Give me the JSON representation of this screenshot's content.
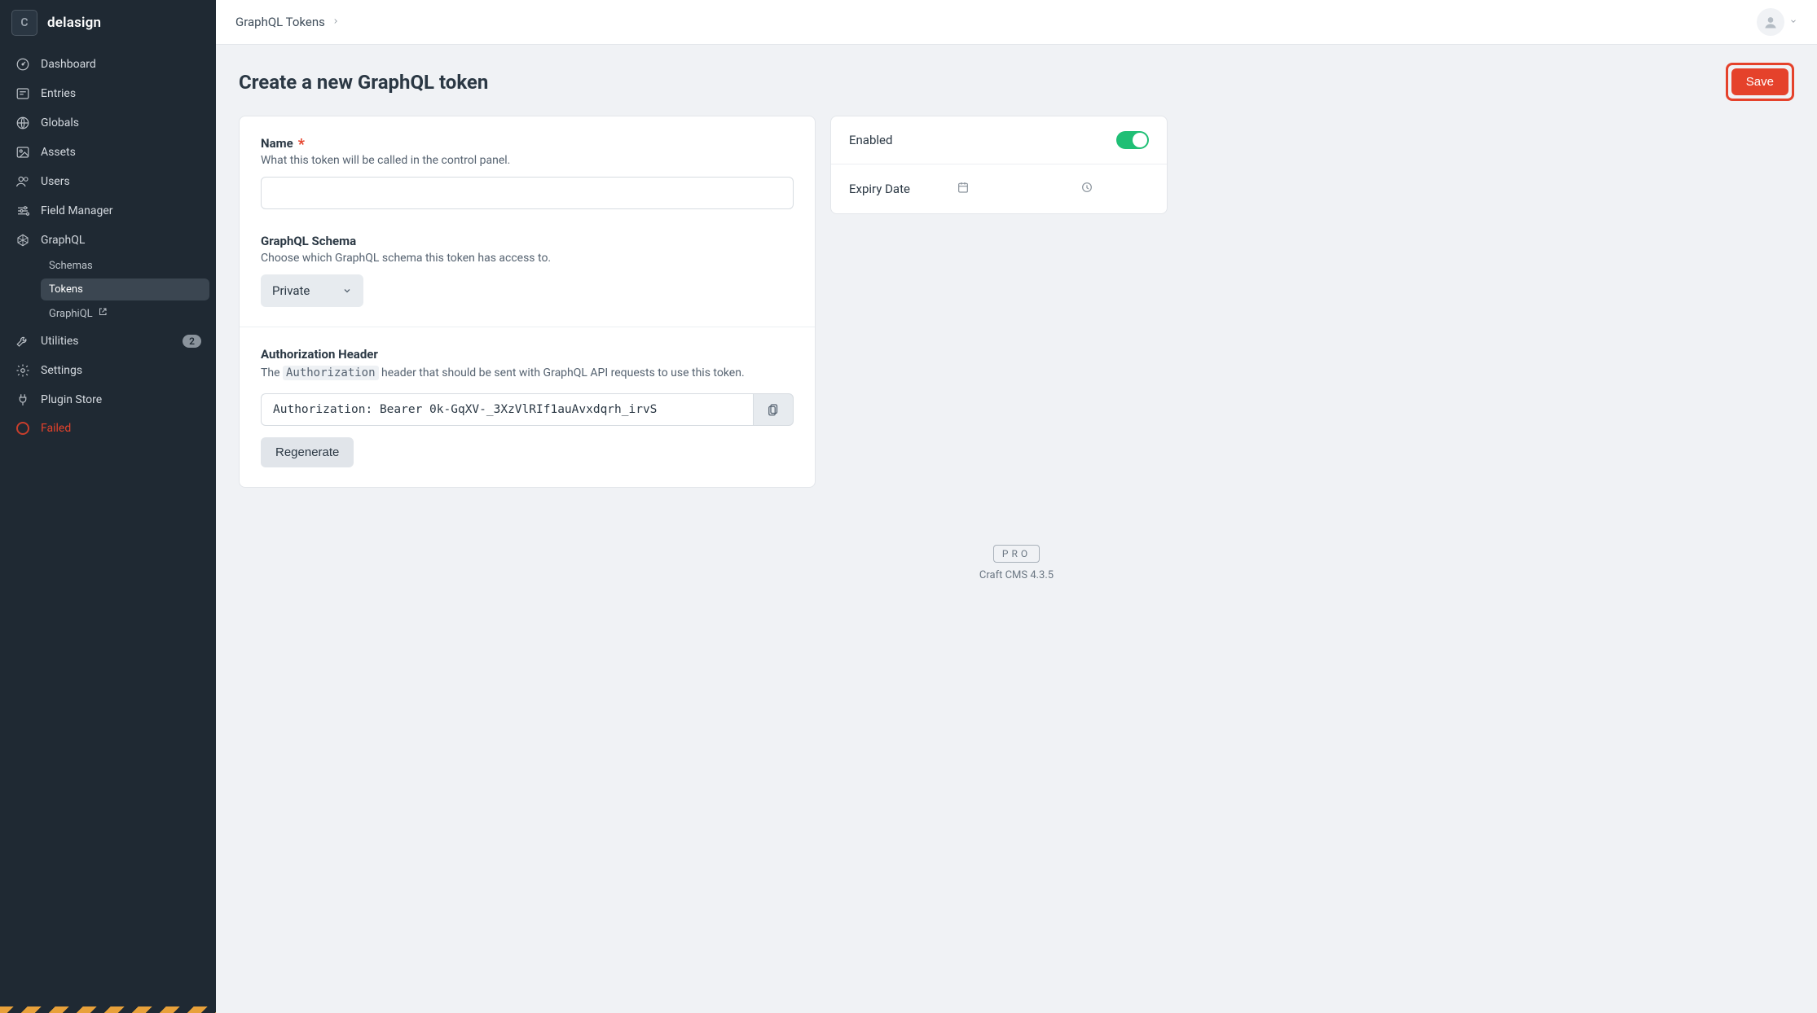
{
  "site": {
    "badge": "C",
    "name": "delasign"
  },
  "nav": {
    "dashboard": "Dashboard",
    "entries": "Entries",
    "globals": "Globals",
    "assets": "Assets",
    "users": "Users",
    "field_manager": "Field Manager",
    "graphql": "GraphQL",
    "graphql_sub": {
      "schemas": "Schemas",
      "tokens": "Tokens",
      "graphiql": "GraphiQL"
    },
    "utilities": "Utilities",
    "utilities_badge": "2",
    "settings": "Settings",
    "plugin_store": "Plugin Store",
    "failed": "Failed"
  },
  "breadcrumbs": {
    "root": "GraphQL Tokens"
  },
  "page": {
    "title": "Create a new GraphQL token",
    "save": "Save"
  },
  "fields": {
    "name": {
      "label": "Name",
      "instructions": "What this token will be called in the control panel."
    },
    "schema": {
      "label": "GraphQL Schema",
      "instructions": "Choose which GraphQL schema this token has access to.",
      "selected": "Private"
    },
    "auth": {
      "label": "Authorization Header",
      "desc_pre": "The ",
      "desc_code": "Authorization",
      "desc_post": " header that should be sent with GraphQL API requests to use this token.",
      "value": "Authorization: Bearer 0k-GqXV-_3XzVlRIf1auAvxdqrh_irvS",
      "regenerate": "Regenerate"
    }
  },
  "side": {
    "enabled": "Enabled",
    "expiry": "Expiry Date"
  },
  "footer": {
    "badge": "PRO",
    "text": "Craft CMS 4.3.5"
  }
}
